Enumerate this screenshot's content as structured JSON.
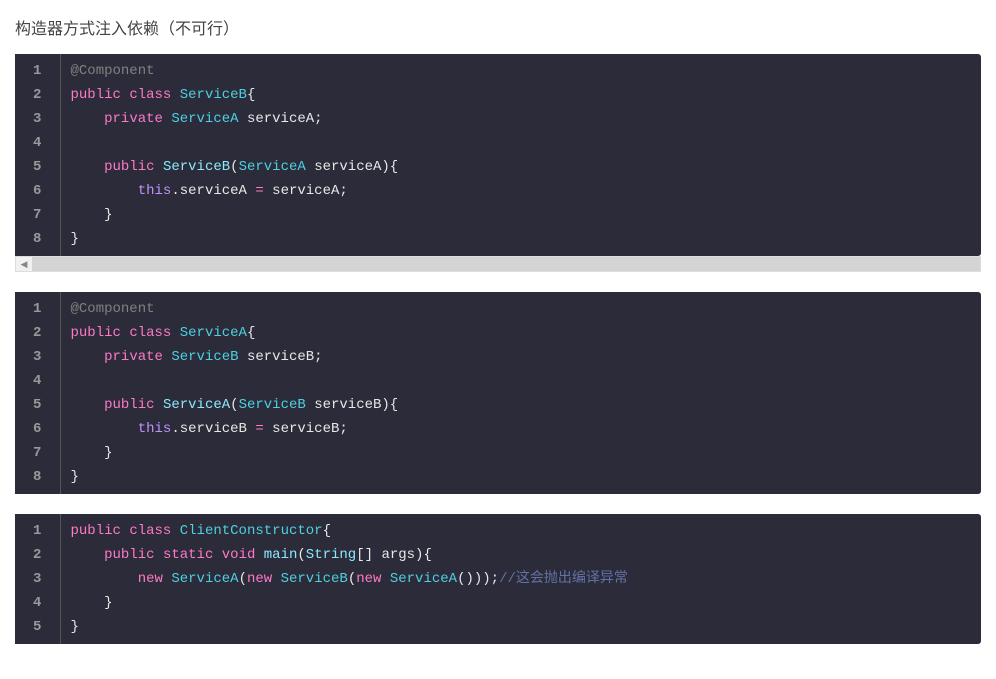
{
  "heading": "构造器方式注入依赖（不可行）",
  "blocks": [
    {
      "lines": [
        {
          "num": "1",
          "tokens": [
            {
              "cls": "annotation",
              "t": "@Component"
            }
          ]
        },
        {
          "num": "2",
          "tokens": [
            {
              "cls": "keyword2",
              "t": "public"
            },
            {
              "cls": "punct",
              "t": " "
            },
            {
              "cls": "keyword2",
              "t": "class"
            },
            {
              "cls": "punct",
              "t": " "
            },
            {
              "cls": "classname",
              "t": "ServiceB"
            },
            {
              "cls": "punct",
              "t": "{"
            }
          ]
        },
        {
          "num": "3",
          "tokens": [
            {
              "cls": "punct",
              "t": "    "
            },
            {
              "cls": "keyword2",
              "t": "private"
            },
            {
              "cls": "punct",
              "t": " "
            },
            {
              "cls": "classname",
              "t": "ServiceA"
            },
            {
              "cls": "punct",
              "t": " "
            },
            {
              "cls": "identifier",
              "t": "serviceA"
            },
            {
              "cls": "punct",
              "t": ";"
            }
          ]
        },
        {
          "num": "4",
          "tokens": []
        },
        {
          "num": "5",
          "tokens": [
            {
              "cls": "punct",
              "t": "    "
            },
            {
              "cls": "keyword2",
              "t": "public"
            },
            {
              "cls": "punct",
              "t": " "
            },
            {
              "cls": "method",
              "t": "ServiceB"
            },
            {
              "cls": "punct",
              "t": "("
            },
            {
              "cls": "classname",
              "t": "ServiceA"
            },
            {
              "cls": "punct",
              "t": " "
            },
            {
              "cls": "identifier",
              "t": "serviceA"
            },
            {
              "cls": "punct",
              "t": "){"
            }
          ]
        },
        {
          "num": "6",
          "tokens": [
            {
              "cls": "punct",
              "t": "        "
            },
            {
              "cls": "this-ref",
              "t": "this"
            },
            {
              "cls": "punct",
              "t": "."
            },
            {
              "cls": "identifier",
              "t": "serviceA"
            },
            {
              "cls": "punct",
              "t": " "
            },
            {
              "cls": "operator",
              "t": "="
            },
            {
              "cls": "punct",
              "t": " "
            },
            {
              "cls": "identifier",
              "t": "serviceA"
            },
            {
              "cls": "punct",
              "t": ";"
            }
          ]
        },
        {
          "num": "7",
          "tokens": [
            {
              "cls": "punct",
              "t": "    }"
            }
          ]
        },
        {
          "num": "8",
          "tokens": [
            {
              "cls": "punct",
              "t": "}"
            }
          ]
        }
      ]
    },
    {
      "lines": [
        {
          "num": "1",
          "tokens": [
            {
              "cls": "annotation",
              "t": "@Component"
            }
          ]
        },
        {
          "num": "2",
          "tokens": [
            {
              "cls": "keyword2",
              "t": "public"
            },
            {
              "cls": "punct",
              "t": " "
            },
            {
              "cls": "keyword2",
              "t": "class"
            },
            {
              "cls": "punct",
              "t": " "
            },
            {
              "cls": "classname",
              "t": "ServiceA"
            },
            {
              "cls": "punct",
              "t": "{"
            }
          ]
        },
        {
          "num": "3",
          "tokens": [
            {
              "cls": "punct",
              "t": "    "
            },
            {
              "cls": "keyword2",
              "t": "private"
            },
            {
              "cls": "punct",
              "t": " "
            },
            {
              "cls": "classname",
              "t": "ServiceB"
            },
            {
              "cls": "punct",
              "t": " "
            },
            {
              "cls": "identifier",
              "t": "serviceB"
            },
            {
              "cls": "punct",
              "t": ";"
            }
          ]
        },
        {
          "num": "4",
          "tokens": []
        },
        {
          "num": "5",
          "tokens": [
            {
              "cls": "punct",
              "t": "    "
            },
            {
              "cls": "keyword2",
              "t": "public"
            },
            {
              "cls": "punct",
              "t": " "
            },
            {
              "cls": "method",
              "t": "ServiceA"
            },
            {
              "cls": "punct",
              "t": "("
            },
            {
              "cls": "classname",
              "t": "ServiceB"
            },
            {
              "cls": "punct",
              "t": " "
            },
            {
              "cls": "identifier",
              "t": "serviceB"
            },
            {
              "cls": "punct",
              "t": "){"
            }
          ]
        },
        {
          "num": "6",
          "tokens": [
            {
              "cls": "punct",
              "t": "        "
            },
            {
              "cls": "this-ref",
              "t": "this"
            },
            {
              "cls": "punct",
              "t": "."
            },
            {
              "cls": "identifier",
              "t": "serviceB"
            },
            {
              "cls": "punct",
              "t": " "
            },
            {
              "cls": "operator",
              "t": "="
            },
            {
              "cls": "punct",
              "t": " "
            },
            {
              "cls": "identifier",
              "t": "serviceB"
            },
            {
              "cls": "punct",
              "t": ";"
            }
          ]
        },
        {
          "num": "7",
          "tokens": [
            {
              "cls": "punct",
              "t": "    }"
            }
          ]
        },
        {
          "num": "8",
          "tokens": [
            {
              "cls": "punct",
              "t": "}"
            }
          ]
        }
      ]
    },
    {
      "lines": [
        {
          "num": "1",
          "tokens": [
            {
              "cls": "keyword2",
              "t": "public"
            },
            {
              "cls": "punct",
              "t": " "
            },
            {
              "cls": "keyword2",
              "t": "class"
            },
            {
              "cls": "punct",
              "t": " "
            },
            {
              "cls": "classname",
              "t": "ClientConstructor"
            },
            {
              "cls": "punct",
              "t": "{"
            }
          ]
        },
        {
          "num": "2",
          "tokens": [
            {
              "cls": "punct",
              "t": "    "
            },
            {
              "cls": "keyword2",
              "t": "public"
            },
            {
              "cls": "punct",
              "t": " "
            },
            {
              "cls": "keyword2",
              "t": "static"
            },
            {
              "cls": "punct",
              "t": " "
            },
            {
              "cls": "keyword2",
              "t": "void"
            },
            {
              "cls": "punct",
              "t": " "
            },
            {
              "cls": "method",
              "t": "main"
            },
            {
              "cls": "punct",
              "t": "("
            },
            {
              "cls": "string-type",
              "t": "String"
            },
            {
              "cls": "punct",
              "t": "[] "
            },
            {
              "cls": "identifier",
              "t": "args"
            },
            {
              "cls": "punct",
              "t": "){"
            }
          ]
        },
        {
          "num": "3",
          "tokens": [
            {
              "cls": "punct",
              "t": "        "
            },
            {
              "cls": "keyword2",
              "t": "new"
            },
            {
              "cls": "punct",
              "t": " "
            },
            {
              "cls": "classname",
              "t": "ServiceA"
            },
            {
              "cls": "punct",
              "t": "("
            },
            {
              "cls": "keyword2",
              "t": "new"
            },
            {
              "cls": "punct",
              "t": " "
            },
            {
              "cls": "classname",
              "t": "ServiceB"
            },
            {
              "cls": "punct",
              "t": "("
            },
            {
              "cls": "keyword2",
              "t": "new"
            },
            {
              "cls": "punct",
              "t": " "
            },
            {
              "cls": "classname",
              "t": "ServiceA"
            },
            {
              "cls": "punct",
              "t": "()));"
            },
            {
              "cls": "comment",
              "t": "//这会抛出编译异常"
            }
          ]
        },
        {
          "num": "4",
          "tokens": [
            {
              "cls": "punct",
              "t": "    }"
            }
          ]
        },
        {
          "num": "5",
          "tokens": [
            {
              "cls": "punct",
              "t": "}"
            }
          ]
        }
      ]
    }
  ],
  "scrollbar_arrow": "◀"
}
